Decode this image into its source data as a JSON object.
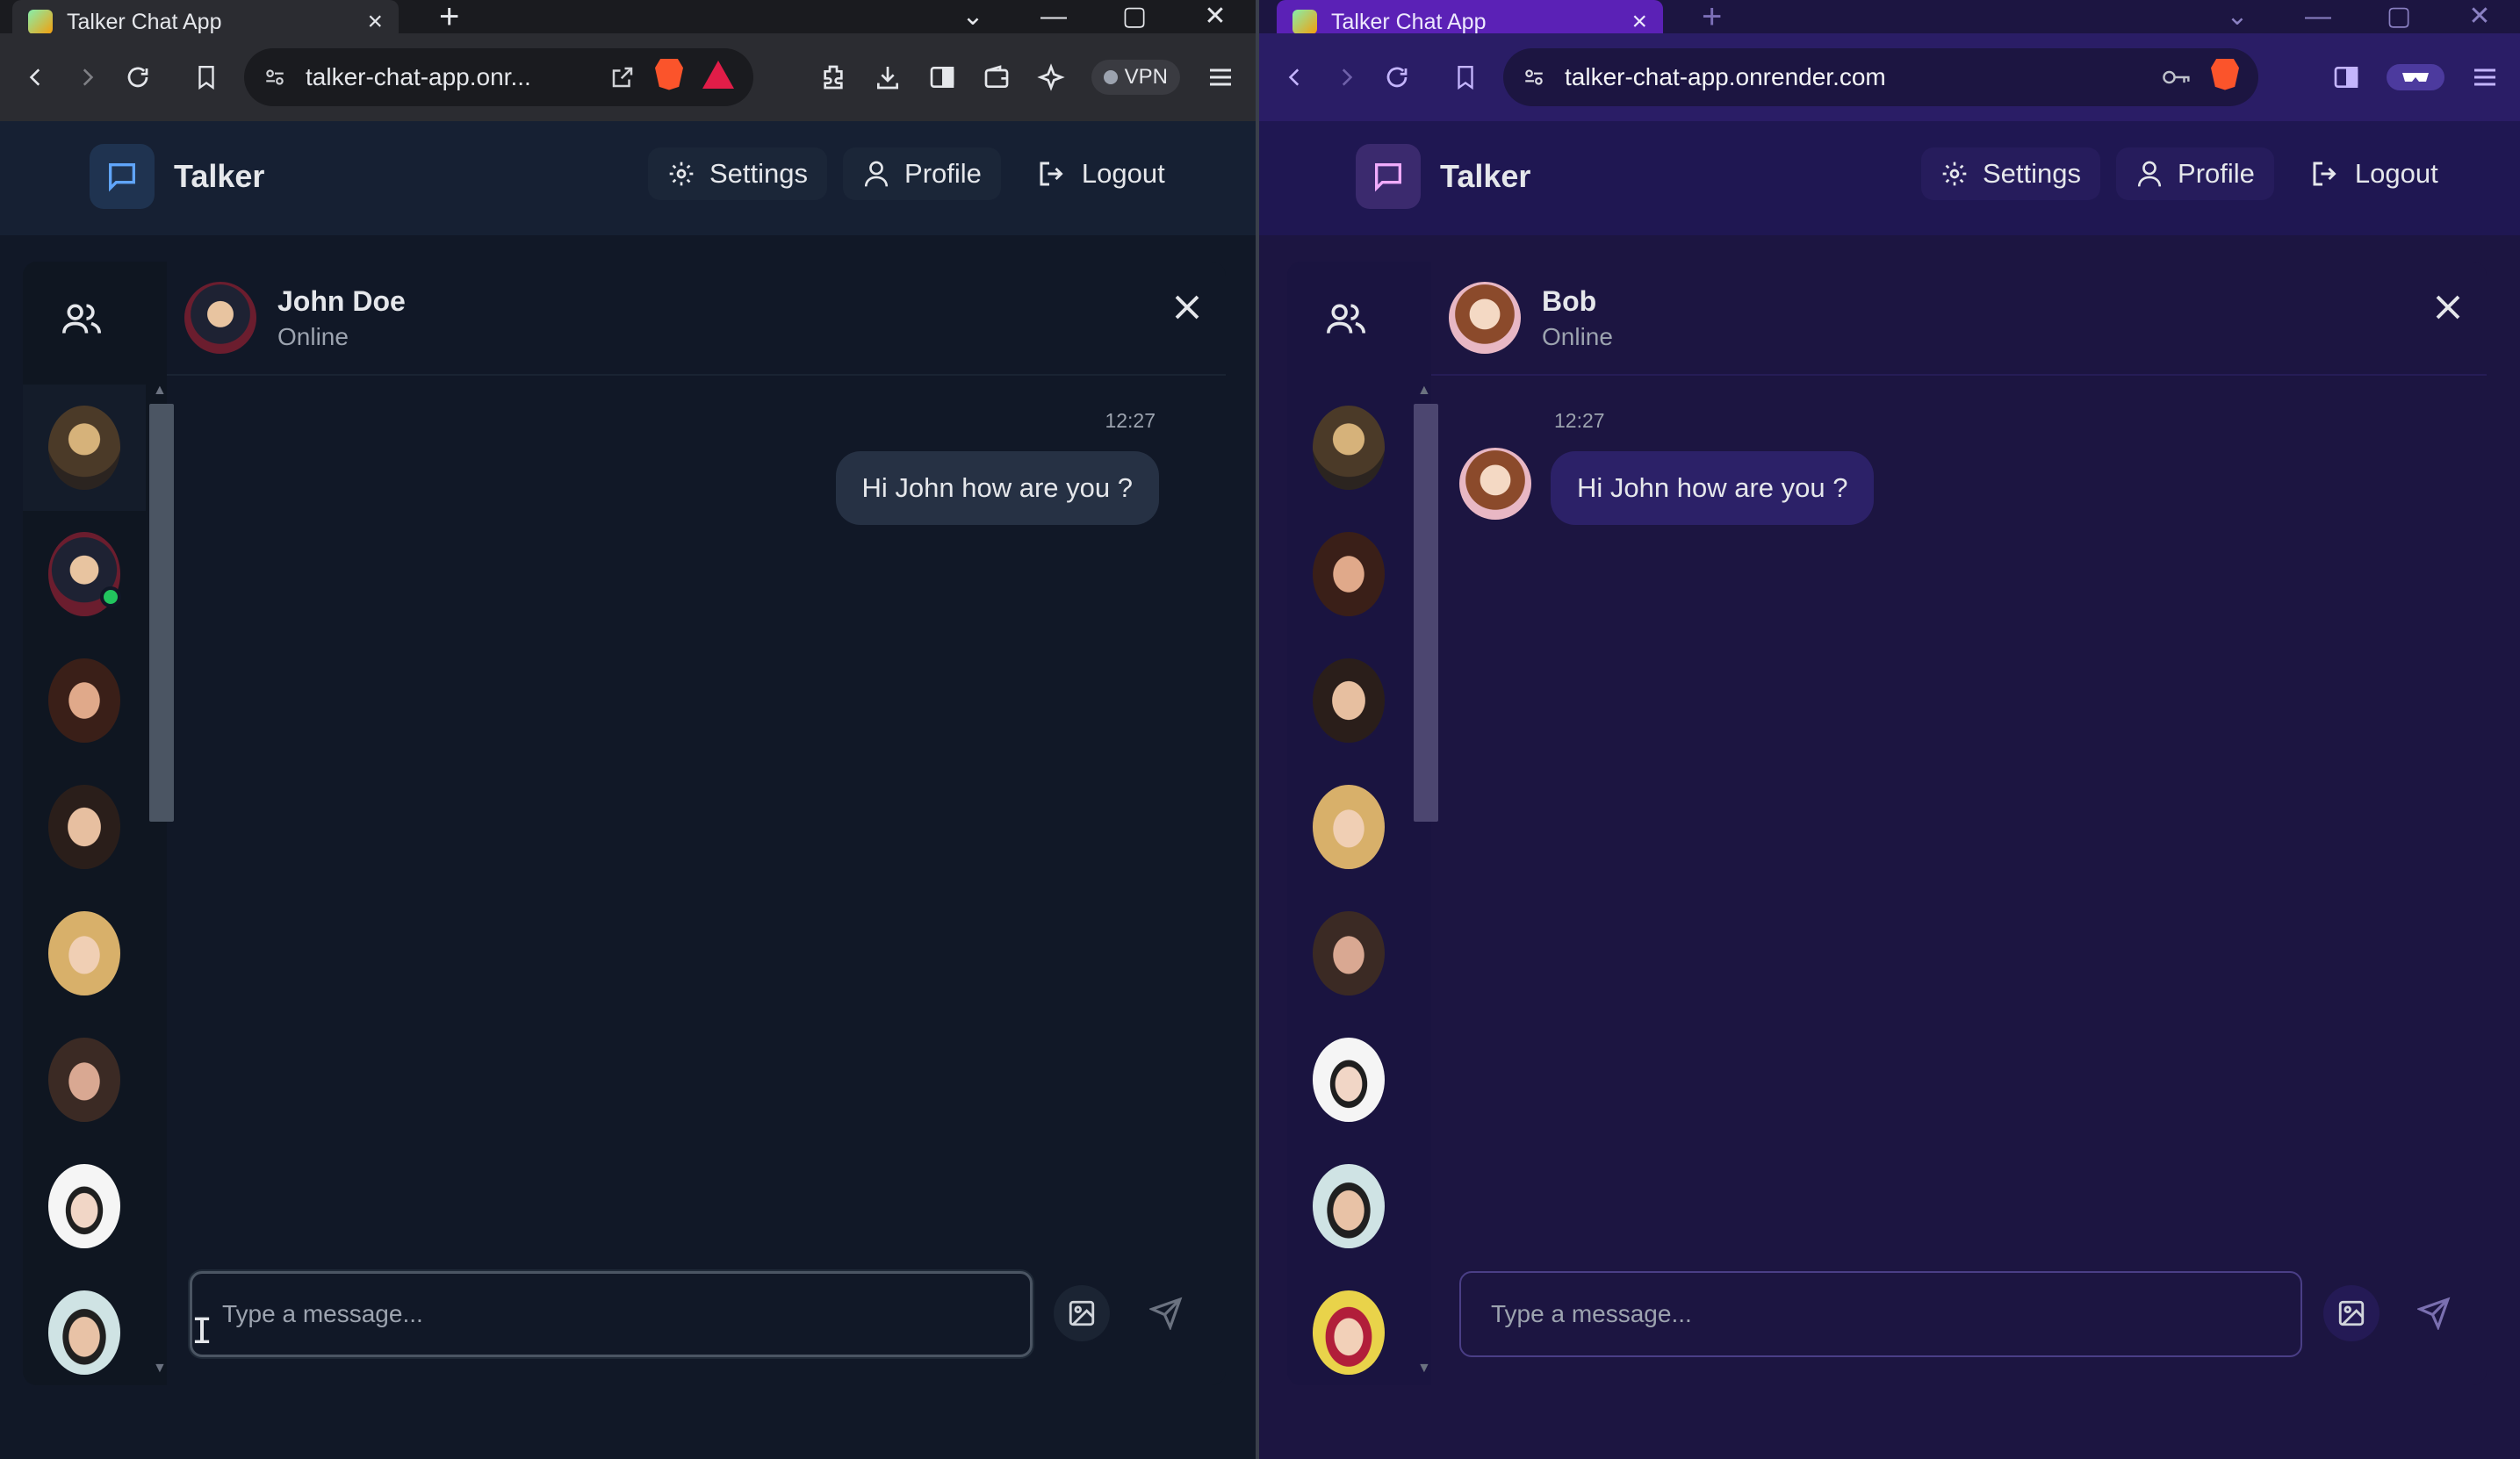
{
  "left_window": {
    "tab": {
      "title": "Talker Chat App",
      "close": "×"
    },
    "newtab": "+",
    "window_controls": {
      "minimize": "—",
      "maximize": "▢",
      "close": "✕"
    },
    "address": {
      "url": "talker-chat-app.onr..."
    },
    "vpn_label": "VPN",
    "app": {
      "brand": "Talker",
      "nav": {
        "settings": "Settings",
        "profile": "Profile",
        "logout": "Logout"
      },
      "chat": {
        "contact_name": "John Doe",
        "contact_status": "Online",
        "messages": [
          {
            "time": "12:27",
            "text": "Hi John how are you ?",
            "direction": "outgoing"
          }
        ],
        "input_placeholder": "Type a message..."
      }
    }
  },
  "right_window": {
    "tab": {
      "title": "Talker Chat App",
      "close": "×"
    },
    "newtab": "+",
    "window_controls": {
      "minimize": "—",
      "maximize": "▢",
      "close": "✕"
    },
    "address": {
      "url": "talker-chat-app.onrender.com"
    },
    "app": {
      "brand": "Talker",
      "nav": {
        "settings": "Settings",
        "profile": "Profile",
        "logout": "Logout"
      },
      "chat": {
        "contact_name": "Bob",
        "contact_status": "Online",
        "messages": [
          {
            "time": "12:27",
            "text": "Hi John how are you ?",
            "direction": "incoming"
          }
        ],
        "input_placeholder": "Type a message..."
      }
    }
  },
  "colors": {
    "left_bg": "#111827",
    "right_bg": "#1c1541",
    "right_tab_accent": "#5b21b6",
    "online": "#22c55e"
  }
}
